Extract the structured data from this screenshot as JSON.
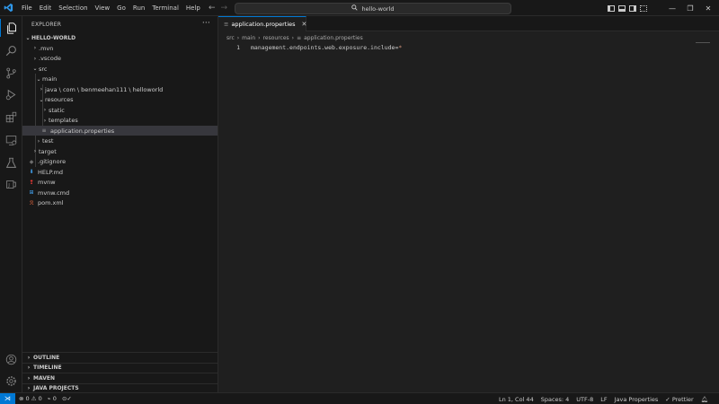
{
  "titlebar": {
    "menu": [
      "File",
      "Edit",
      "Selection",
      "View",
      "Go",
      "Run",
      "Terminal",
      "Help"
    ],
    "search_text": "hello-world",
    "icons": [
      "vscode-logo-icon",
      "back-arrow-icon",
      "forward-arrow-icon",
      "search-icon",
      "toggle-sidebar-icon",
      "toggle-panel-icon",
      "toggle-secondary-sidebar-icon",
      "customize-layout-icon",
      "minimize-icon",
      "restore-icon",
      "close-icon"
    ],
    "accent_color": "#0078d4"
  },
  "activitybar": {
    "items": [
      "explorer-icon",
      "search-icon",
      "source-control-icon",
      "run-debug-icon",
      "extensions-icon",
      "remote-explorer-icon",
      "testing-icon",
      "java-projects-icon"
    ],
    "bottom": [
      "account-icon",
      "manage-gear-icon"
    ]
  },
  "sidebar": {
    "title": "EXPLORER",
    "root": "HELLO-WORLD",
    "tree": [
      {
        "label": ".mvn",
        "type": "folder",
        "state": "collapsed"
      },
      {
        "label": ".vscode",
        "type": "folder",
        "state": "collapsed"
      },
      {
        "label": "src",
        "type": "folder",
        "state": "expanded"
      },
      {
        "label": "main",
        "type": "folder",
        "state": "expanded"
      },
      {
        "label": "java \\ com \\ benmeehan111 \\ helloworld",
        "type": "folder",
        "state": "collapsed"
      },
      {
        "label": "resources",
        "type": "folder",
        "state": "expanded"
      },
      {
        "label": "static",
        "type": "folder",
        "state": "collapsed"
      },
      {
        "label": "templates",
        "type": "folder",
        "state": "collapsed"
      },
      {
        "label": "application.properties",
        "type": "file",
        "state": "selected"
      },
      {
        "label": "test",
        "type": "folder",
        "state": "collapsed"
      },
      {
        "label": "target",
        "type": "folder",
        "state": "collapsed"
      },
      {
        "label": ".gitignore",
        "type": "file"
      },
      {
        "label": "HELP.md",
        "type": "file"
      },
      {
        "label": "mvnw",
        "type": "file"
      },
      {
        "label": "mvnw.cmd",
        "type": "file"
      },
      {
        "label": "pom.xml",
        "type": "file"
      }
    ],
    "panels": [
      "OUTLINE",
      "TIMELINE",
      "MAVEN",
      "JAVA PROJECTS"
    ]
  },
  "editor": {
    "tab_label": "application.properties",
    "breadcrumb": [
      "src",
      "main",
      "resources",
      "application.properties"
    ],
    "line_number": "1",
    "code_key": "management.endpoints.web.exposure.include=",
    "code_value": "*"
  },
  "statusbar": {
    "errors": "0",
    "warnings": "0",
    "ports": "0",
    "position": "Ln 1, Col 44",
    "spaces": "Spaces: 4",
    "encoding": "UTF-8",
    "eol": "LF",
    "language": "Java Properties",
    "formatter": "Prettier"
  }
}
